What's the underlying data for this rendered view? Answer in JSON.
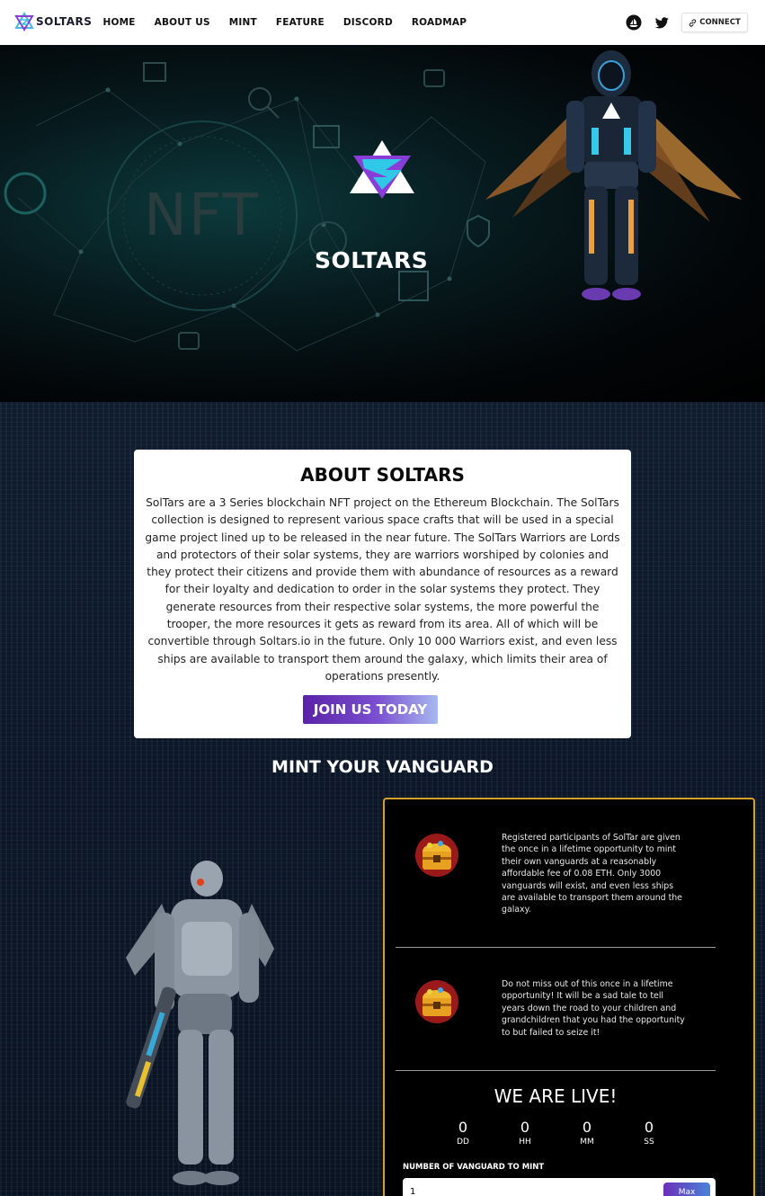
{
  "brand": {
    "name": "SOLTARS"
  },
  "nav": {
    "links": [
      "HOME",
      "ABOUT US",
      "MINT",
      "FEATURE",
      "DISCORD",
      "ROADMAP"
    ],
    "connect_label": "CONNECT"
  },
  "hero": {
    "background_word": "NFT",
    "logo_text": "SOLTARS"
  },
  "about": {
    "title": "ABOUT SOLTARS",
    "body": "SolTars are a 3 Series blockchain NFT project on the Ethereum Blockchain. The SolTars collection is designed to represent various space crafts that will be used in a special game project lined up to be released in the near future. The SolTars Warriors are Lords and protectors of their solar systems, they are warriors worshiped by colonies and they protect their citizens and provide them with abundance of resources as a reward for their loyalty and dedication to order in the solar systems they protect. They generate resources from their respective solar systems, the more powerful the trooper, the more resources it gets as reward from its area. All of which will be convertible through Soltars.io in the future. Only 10 000 Warriors exist, and even less ships are available to transport them around the galaxy, which limits their area of operations presently.",
    "cta": "JOIN US TODAY"
  },
  "mint": {
    "title": "MINT YOUR VANGUARD",
    "features": [
      "Registered participants of SolTar are given the once in a lifetime opportunity to mint their own vanguards at a reasonably affordable fee of 0.08 ETH. Only 3000 vanguards will exist, and even less ships are available to transport them around the galaxy.",
      "Do not miss out of this once in a lifetime opportunity! It will be a sad tale to tell years down the road to your children and grandchildren that you had the opportunity to but failed to seize it!"
    ],
    "live_title": "WE ARE LIVE!",
    "countdown": [
      {
        "value": "0",
        "label": "DD"
      },
      {
        "value": "0",
        "label": "HH"
      },
      {
        "value": "0",
        "label": "MM"
      },
      {
        "value": "0",
        "label": "SS"
      }
    ],
    "quantity_label": "NUMBER OF VANGUARD TO MINT",
    "quantity_value": "1",
    "max_label": "Max"
  },
  "colors": {
    "accent_purple": "#5a22a8",
    "panel_border": "#d4a027"
  }
}
